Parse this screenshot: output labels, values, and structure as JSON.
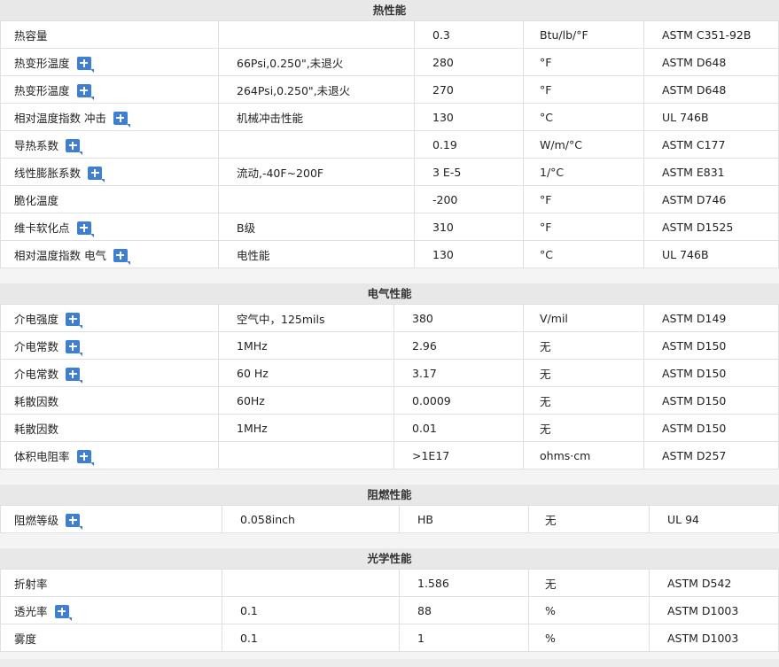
{
  "sections": [
    {
      "id": "thermal",
      "title": "热性能",
      "rows": [
        {
          "name": "热容量",
          "plus": false,
          "condition": "",
          "value": "0.3",
          "unit": "Btu/lb/°F",
          "standard": "ASTM C351-92B"
        },
        {
          "name": "热变形温度",
          "plus": true,
          "condition": "66Psi,0.250\",未退火",
          "value": "280",
          "unit": "°F",
          "standard": "ASTM D648"
        },
        {
          "name": "热变形温度",
          "plus": true,
          "condition": "264Psi,0.250\",未退火",
          "value": "270",
          "unit": "°F",
          "standard": "ASTM D648"
        },
        {
          "name": "相对温度指数 冲击",
          "plus": true,
          "condition": "机械冲击性能",
          "value": "130",
          "unit": "°C",
          "standard": "UL 746B"
        },
        {
          "name": "导热系数",
          "plus": true,
          "condition": "",
          "value": "0.19",
          "unit": "W/m/°C",
          "standard": "ASTM C177"
        },
        {
          "name": "线性膨胀系数",
          "plus": true,
          "condition": "流动,-40F~200F",
          "value": "3 E-5",
          "unit": "1/°C",
          "standard": "ASTM E831"
        },
        {
          "name": "脆化温度",
          "plus": false,
          "condition": "",
          "value": "-200",
          "unit": "°F",
          "standard": "ASTM D746"
        },
        {
          "name": "维卡软化点",
          "plus": true,
          "condition": "B级",
          "value": "310",
          "unit": "°F",
          "standard": "ASTM D1525"
        },
        {
          "name": "相对温度指数 电气",
          "plus": true,
          "condition": "电性能",
          "value": "130",
          "unit": "°C",
          "standard": "UL 746B"
        }
      ]
    },
    {
      "id": "electrical",
      "title": "电气性能",
      "rows": [
        {
          "name": "介电强度",
          "plus": true,
          "condition": "空气中，125mils",
          "value": "380",
          "unit": "V/mil",
          "standard": "ASTM D149"
        },
        {
          "name": "介电常数",
          "plus": true,
          "condition": "1MHz",
          "value": "2.96",
          "unit": "无",
          "standard": "ASTM D150"
        },
        {
          "name": "介电常数",
          "plus": true,
          "condition": "60 Hz",
          "value": "3.17",
          "unit": "无",
          "standard": "ASTM D150"
        },
        {
          "name": "耗散因数",
          "plus": false,
          "condition": "60Hz",
          "value": "0.0009",
          "unit": "无",
          "standard": "ASTM D150"
        },
        {
          "name": "耗散因数",
          "plus": false,
          "condition": "1MHz",
          "value": "0.01",
          "unit": "无",
          "standard": "ASTM D150"
        },
        {
          "name": "体积电阻率",
          "plus": true,
          "condition": "",
          "value": ">1E17",
          "unit": "ohms·cm",
          "standard": "ASTM D257"
        }
      ]
    },
    {
      "id": "flame",
      "title": "阻燃性能",
      "rows": [
        {
          "name": "阻燃等级",
          "plus": true,
          "condition": "0.058inch",
          "value": "HB",
          "unit": "无",
          "standard": "UL 94"
        }
      ]
    },
    {
      "id": "optical",
      "title": "光学性能",
      "rows": [
        {
          "name": "折射率",
          "plus": false,
          "condition": "",
          "value": "1.586",
          "unit": "无",
          "standard": "ASTM D542"
        },
        {
          "name": "透光率",
          "plus": true,
          "condition": "0.1",
          "value": "88",
          "unit": "%",
          "standard": "ASTM D1003"
        },
        {
          "name": "雾度",
          "plus": false,
          "condition": "0.1",
          "value": "1",
          "unit": "%",
          "standard": "ASTM D1003"
        }
      ]
    }
  ],
  "icons": {
    "expand": "plus-expand-icon"
  },
  "colors": {
    "accent": "#3f7fd1",
    "header_bg": "#e8e8e8"
  }
}
